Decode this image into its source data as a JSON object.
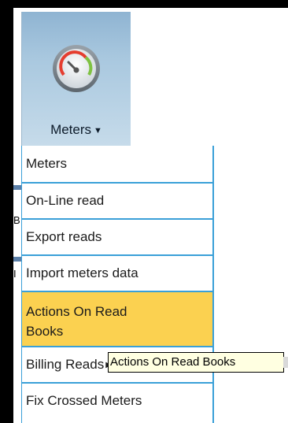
{
  "tile": {
    "label": "Meters",
    "caret": "▼",
    "icon": "gauge-icon",
    "gauge_colors": {
      "arc": "#e53d2f",
      "arc_end": "#7fc241",
      "needle": "#555555"
    }
  },
  "menu": {
    "items": [
      {
        "label": "Meters"
      },
      {
        "label": "On-Line read"
      },
      {
        "label": "Export reads"
      },
      {
        "label": "Import meters data"
      },
      {
        "label": "Actions On Read Books",
        "active": true
      },
      {
        "label": "Billing Reads",
        "submenu_arrow": "▶"
      },
      {
        "label": "Fix Crossed Meters"
      }
    ],
    "border_color": "#3aa0d8",
    "active_color": "#fbd150"
  },
  "tooltip": {
    "text": "Actions On Read Books"
  },
  "background_fragments": [
    "B",
    "I"
  ]
}
